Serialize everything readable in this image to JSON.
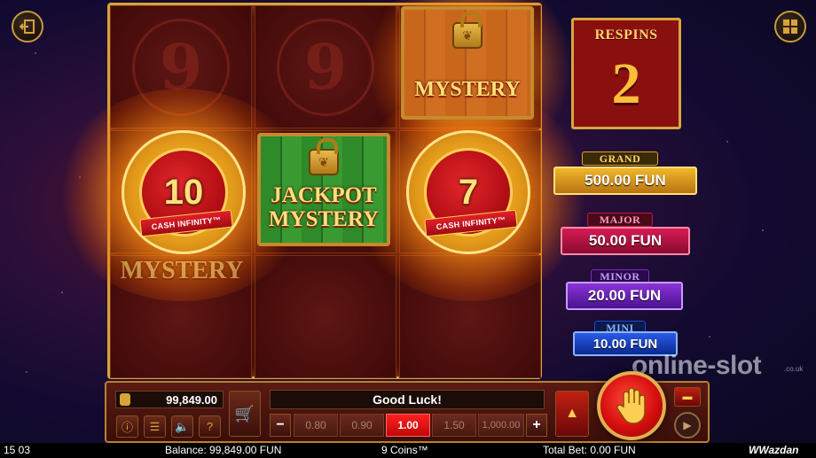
{
  "reels": {
    "coins": [
      {
        "value": "10",
        "ribbon": "CASH INFINITY™"
      },
      {
        "value": "7",
        "ribbon": "CASH INFINITY™"
      }
    ],
    "mystery_top": "MYSTERY",
    "jackpot_mystery_line1": "JACKPOT",
    "jackpot_mystery_line2": "MYSTERY",
    "faded_mystery": "MYSTERY",
    "ghost_symbol": "9"
  },
  "respins": {
    "label": "RESPINS",
    "count": "2"
  },
  "jackpots": [
    {
      "name": "GRAND",
      "value": "500.00 FUN",
      "color": "#e0a21c"
    },
    {
      "name": "MAJOR",
      "value": "50.00 FUN",
      "color": "#c0184a"
    },
    {
      "name": "MINOR",
      "value": "20.00 FUN",
      "color": "#7a2ac8"
    },
    {
      "name": "MINI",
      "value": "10.00 FUN",
      "color": "#1a4ad0"
    }
  ],
  "panel": {
    "balance": "99,849.00",
    "message": "Good Luck!",
    "bets": [
      "0.80",
      "0.90",
      "1.00",
      "1.50",
      "1,000.00"
    ],
    "selected_bet": "1.00",
    "minus": "−",
    "plus": "+"
  },
  "status_bar": {
    "time": "15 03",
    "balance": "Balance: 99,849.00 FUN",
    "game": "9 Coins™",
    "total_bet": "Total Bet: 0.00 FUN",
    "brand": "Wazdan"
  },
  "watermark": {
    "main": "online-slot",
    "sub": ".co.uk"
  },
  "icons": {
    "exit": "exit-icon",
    "menu": "grid-menu-icon",
    "info": "info-icon",
    "list": "hamburger-icon",
    "sound": "speaker-icon",
    "help": "question-icon",
    "cart": "shopping-cart-icon",
    "spin": "hand-stop-icon",
    "turbo": "flame-icon",
    "autoplay": "autoplay-icon"
  }
}
